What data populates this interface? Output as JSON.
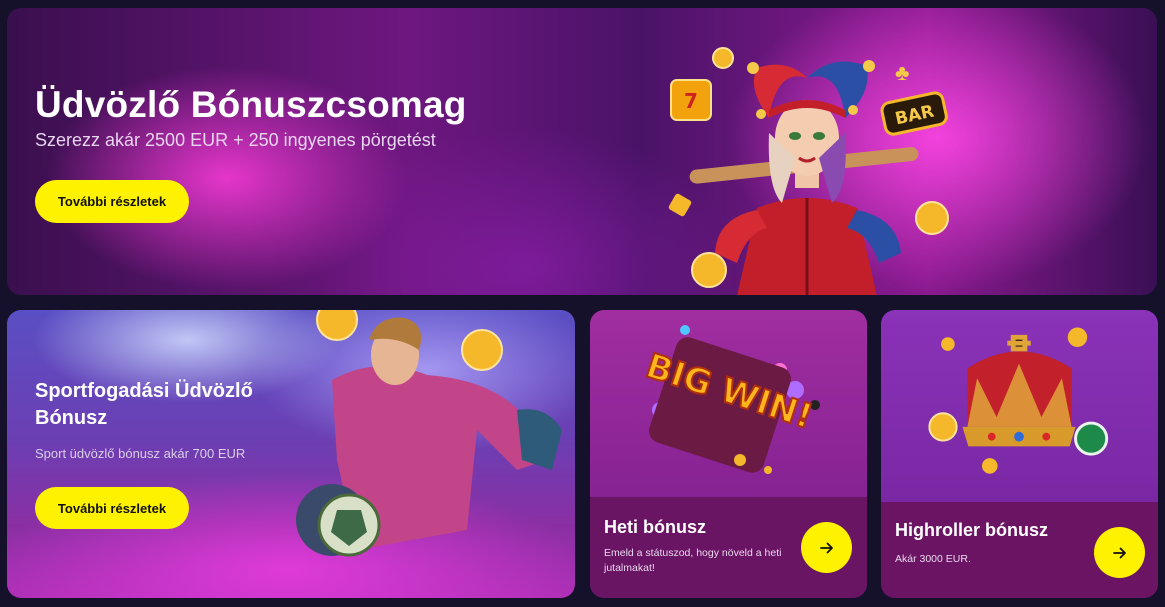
{
  "hero": {
    "title": "Üdvözlő Bónuszcsomag",
    "subtitle": "Szerezz akár 2500 EUR + 250 ingyenes pörgetést",
    "button_label": "További részletek"
  },
  "sport_card": {
    "title": "Sportfogadási Üdvözlő Bónusz",
    "subtitle": "Sport üdvözlő bónusz akár 700 EUR",
    "button_label": "További részletek"
  },
  "weekly_card": {
    "art_text": "BIG WIN!",
    "title": "Heti bónusz",
    "description": "Emeld a státuszod, hogy növeld a heti jutalmakat!",
    "arrow_icon": "arrow-right-icon"
  },
  "highroller_card": {
    "title": "Highroller bónusz",
    "description": "Akár 3000 EUR.",
    "arrow_icon": "arrow-right-icon"
  },
  "jester_art": {
    "bar_label": "BAR"
  },
  "colors": {
    "accent_yellow": "#fff200",
    "background": "#15112b",
    "card_bottom": "#6a1464"
  }
}
